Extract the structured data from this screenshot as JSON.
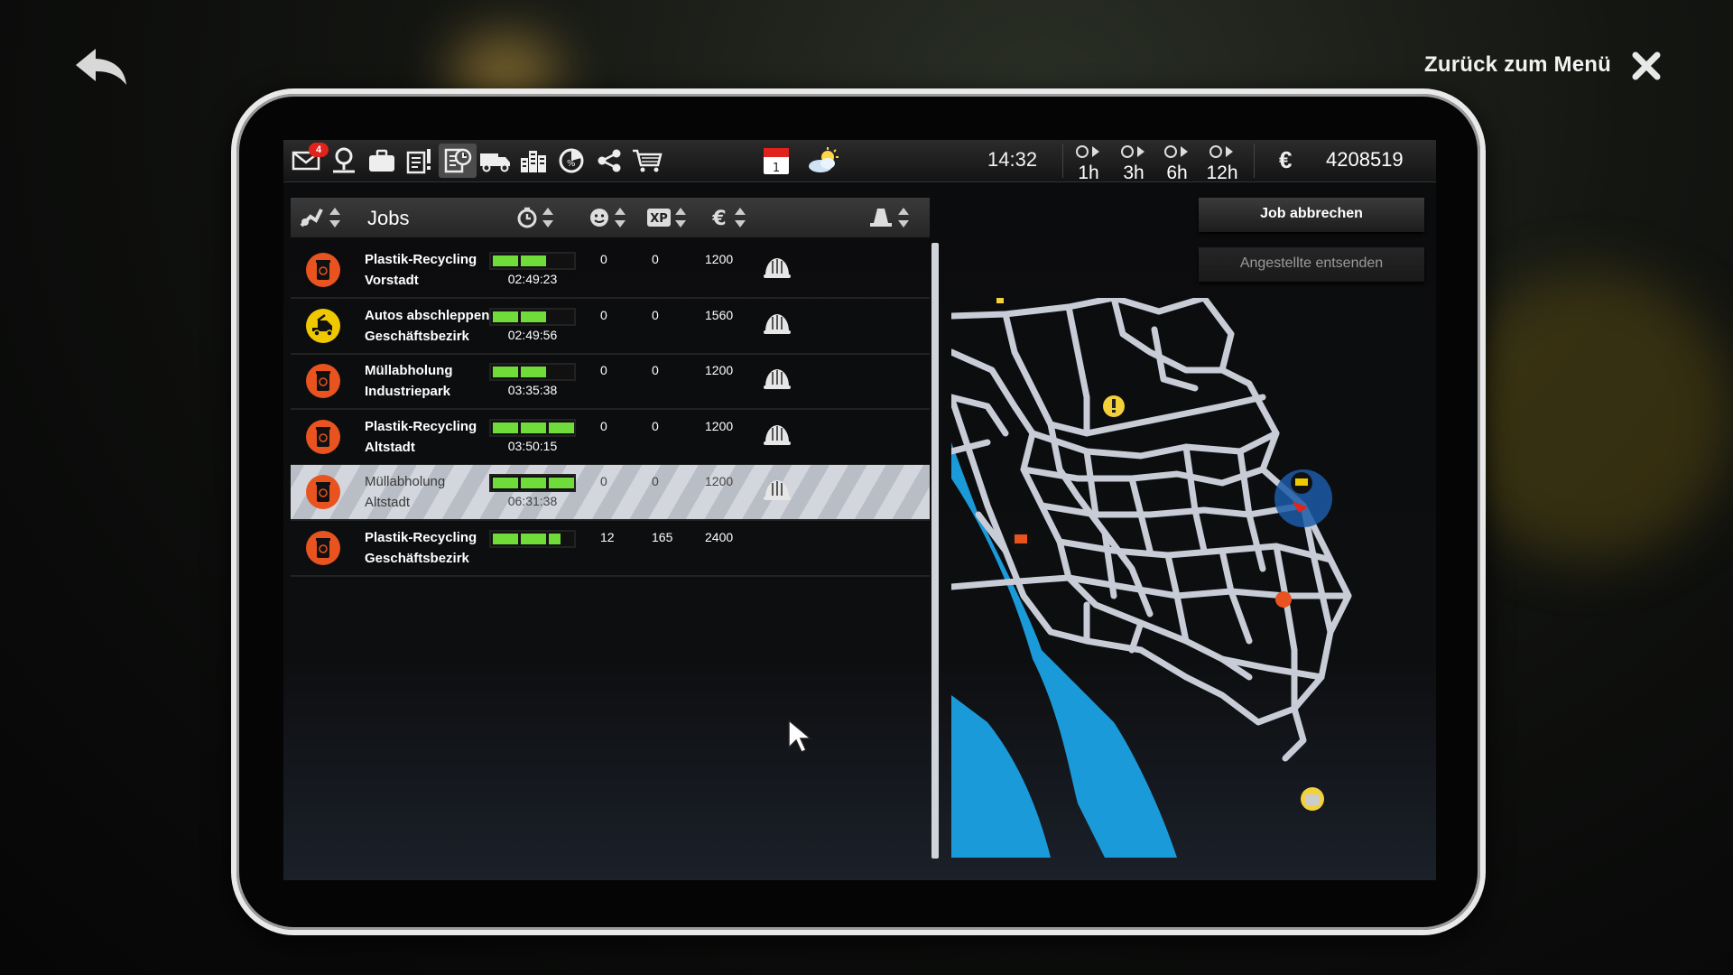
{
  "header": {
    "menu_back_label": "Zurück zum Menü"
  },
  "toolbar": {
    "mail_badge": "4",
    "calendar_day": "1",
    "time": "14:32",
    "speeds": [
      "1h",
      "3h",
      "6h",
      "12h"
    ],
    "money": "4208519",
    "currency_symbol": "€"
  },
  "jobs": {
    "title": "Jobs",
    "columns": [
      "time-icon",
      "satisfaction-icon",
      "XP",
      "€",
      "worker-icon"
    ],
    "rows": [
      {
        "name": "Plastik-Recycling",
        "location": "Vorstadt",
        "progress": 0.67,
        "time": "02:49:23",
        "satisfaction": "0",
        "xp": "0",
        "money": "1200",
        "icon": "recycling-icon",
        "selected": false,
        "helmet": true
      },
      {
        "name": "Autos abschleppen",
        "location": "Geschäftsbezirk",
        "progress": 0.67,
        "time": "02:49:56",
        "satisfaction": "0",
        "xp": "0",
        "money": "1560",
        "icon": "tow-truck-icon",
        "selected": false,
        "helmet": true
      },
      {
        "name": "Müllabholung",
        "location": "Industriepark",
        "progress": 0.67,
        "time": "03:35:38",
        "satisfaction": "0",
        "xp": "0",
        "money": "1200",
        "icon": "garbage-icon",
        "selected": false,
        "helmet": true
      },
      {
        "name": "Plastik-Recycling",
        "location": "Altstadt",
        "progress": 1.0,
        "time": "03:50:15",
        "satisfaction": "0",
        "xp": "0",
        "money": "1200",
        "icon": "recycling-icon",
        "selected": false,
        "helmet": true
      },
      {
        "name": "Müllabholung",
        "location": "Altstadt",
        "progress": 1.0,
        "time": "06:31:38",
        "satisfaction": "0",
        "xp": "0",
        "money": "1200",
        "icon": "garbage-icon",
        "selected": true,
        "helmet": true
      },
      {
        "name": "Plastik-Recycling",
        "location": "Geschäftsbezirk",
        "progress": 0.83,
        "time": "",
        "satisfaction": "12",
        "xp": "165",
        "money": "2400",
        "icon": "recycling-icon",
        "selected": false,
        "helmet": false
      }
    ]
  },
  "buttons": {
    "cancel_job": "Job abbrechen",
    "send_employees": "Angestellte entsenden"
  },
  "colors": {
    "progress": "#6fdc3a",
    "job_orange": "#e8531f",
    "job_yellow": "#f0c800",
    "water": "#1a9ad8",
    "road": "#c8ccd6"
  }
}
